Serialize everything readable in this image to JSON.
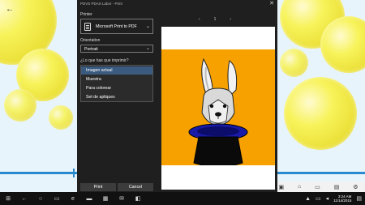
{
  "dialog": {
    "title": "PDVS PDAS Labor - Print",
    "close_glyph": "✕",
    "printer_label": "Printer",
    "printer_value": "Microsoft Print to PDF",
    "orientation_label": "Orientation",
    "orientation_value": "Portrait",
    "what_label": "¿Lo que has que imprimir?",
    "options": [
      "Imagen actual",
      "Muestra",
      "Para colorear",
      "Set de apliques"
    ],
    "selected_option": "Imagen actual",
    "print_label": "Print",
    "cancel_label": "Cancel",
    "page_number": "1",
    "prev_glyph": "‹",
    "next_glyph": "›"
  },
  "taskbar": {
    "time": "3:24 AM",
    "date": "11/14/2015"
  },
  "colors": {
    "dialog_bg": "#1f1f1f",
    "selected_option_bg": "#3a5b7f",
    "art_bg": "#f7a100",
    "hat_blue": "#1a1aa8",
    "accent_blue": "#2a8ad0"
  },
  "icons": {
    "back": "back-arrow-icon",
    "printer": "printer-icon",
    "windows": "windows-logo-icon",
    "search": "search-icon",
    "task_view": "task-view-icon",
    "edge": "edge-icon",
    "folder": "folder-icon",
    "store": "store-icon",
    "mail": "mail-icon"
  }
}
